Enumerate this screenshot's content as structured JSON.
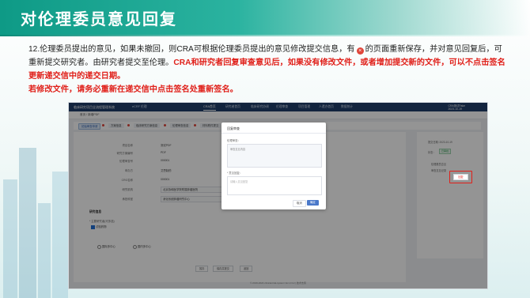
{
  "slide": {
    "title": "对伦理委员意见回复",
    "para1_start": "12.伦理委员提出的意见，如果未撤回，则CRA可根据伦理委员提出的意见修改提交信息，有",
    "delete_symbol": "×",
    "para1_mid": "的页面重新保存，并对意见回复后，可重新提交研究者。由研究者提交至伦理。",
    "para1_red": "CRA和研究者回复审查意见后，如果没有修改文件，或者增加提交新的文件，可以不点击签名更新递交信中的递交日期。",
    "para2_red": "若修改文件，请务必重新在递交信中点击签名处重新签名。"
  },
  "app": {
    "top_nav": {
      "logo_text": "临床研究项目全流程管理系统",
      "project": "eCRF 伦理",
      "tabs": [
        {
          "label": "CRA首页"
        },
        {
          "label": "研究者首页"
        },
        {
          "label": "临床研究协调"
        },
        {
          "label": "伦理审查"
        },
        {
          "label": "项目管理"
        },
        {
          "label": "人遗办首页"
        },
        {
          "label": "数据统计"
        }
      ],
      "user_name": "CRA测试Fake",
      "user_time": "2023-10-19"
    },
    "subbar_text": "首页 / 新增PDF",
    "steps": [
      {
        "label": "初始审查申请"
      },
      {
        "label": "方案信息"
      },
      {
        "label": "临床研究方案信息"
      },
      {
        "label": "伦理审查信息"
      },
      {
        "label": "材料附件提交"
      },
      {
        "label": "审查意见"
      },
      {
        "label": "提交"
      }
    ],
    "form_rows": [
      {
        "label": "项目名称",
        "value": "测试PDF"
      },
      {
        "label": "研究方案编号",
        "value": "PDF"
      },
      {
        "label": "伦理审查号",
        "value": "000001"
      },
      {
        "label": "申办方",
        "value": "艾思制药"
      },
      {
        "label": "CRO名称",
        "value": "000001"
      },
      {
        "label": "研究机构",
        "value": "北京协和医学院附属肿瘤医院"
      },
      {
        "label": "承担科室",
        "value": "消化系统肿瘤研究中心"
      }
    ],
    "section_title": "研究信息",
    "field_label": "* 主要研究者(可多选)",
    "option_checked": "试验药物",
    "option_a": "国际多中心",
    "option_b": "国内多中心",
    "footer_buttons": [
      {
        "label": "暂存"
      },
      {
        "label": "保存并提交"
      },
      {
        "label": "返回"
      }
    ],
    "footer_text": "© 2019-2024 clinical-trial-system Ver 2.3.2 | 技术支持",
    "right_panel": {
      "meta": "提交日期: 2023-10-19",
      "status_label": "状态：",
      "status_tag": "已审批",
      "item1": "伦理委员意见",
      "item2": "审查意见记录",
      "reply_button": "回复"
    },
    "modal": {
      "title": "回复审查",
      "opinion_label": "伦理审查：",
      "opinion_text": "审查意见内容",
      "reply_label": "* 意见回复：",
      "reply_placeholder": "请输入意见回复",
      "cancel_label": "取消",
      "ok_label": "确定"
    }
  },
  "colors": {
    "title_bar": "#0e9a86",
    "red_text": "#e0201a",
    "nav_bg": "#1f3e6b",
    "primary_btn": "#4a78c9"
  }
}
